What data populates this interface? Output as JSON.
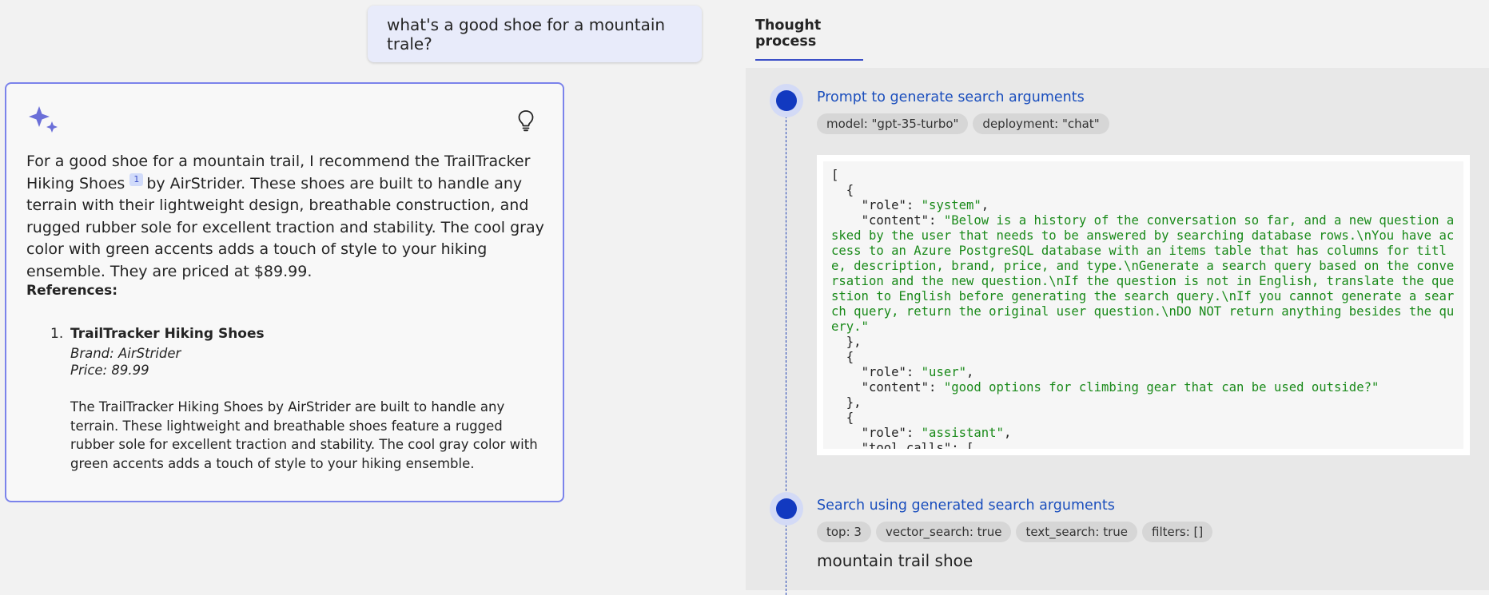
{
  "chat": {
    "user_question": "what's a good shoe for a mountain trale?",
    "answer": {
      "text_before_citation": "For a good shoe for a mountain trail, I recommend the TrailTracker Hiking Shoes",
      "citation": "1",
      "text_after_citation": "by AirStrider. These shoes are built to handle any terrain with their lightweight design, breathable construction, and rugged rubber sole for excellent traction and stability. The cool gray color with green accents adds a touch of style to your hiking ensemble. They are priced at $89.99.",
      "references_heading": "References:",
      "references": [
        {
          "number": "1.",
          "title": "TrailTracker Hiking Shoes",
          "brand": "Brand: AirStrider",
          "price": "Price: 89.99",
          "description": "The TrailTracker Hiking Shoes by AirStrider are built to handle any terrain. These lightweight and breathable shoes feature a rugged rubber sole for excellent traction and stability. The cool gray color with green accents adds a touch of style to your hiking ensemble."
        }
      ]
    },
    "icons": {
      "assistant": "sparkle-icon",
      "thought_process": "lightbulb-icon"
    }
  },
  "thought_process": {
    "tab_label": "Thought process",
    "steps": [
      {
        "title": "Prompt to generate search arguments",
        "chips": [
          "model: \"gpt-35-turbo\"",
          "deployment: \"chat\""
        ],
        "code_lines": [
          "[",
          "  {",
          "    \"role\": \"system\",",
          "    \"content\": \"Below is a history of the conversation so far, and a new question asked by the user that needs to be answered by searching database rows.\\nYou have access to an Azure PostgreSQL database with an items table that has columns for title, description, brand, price, and type.\\nGenerate a search query based on the conversation and the new question.\\nIf the question is not in English, translate the question to English before generating the search query.\\nIf you cannot generate a search query, return the original user question.\\nDO NOT return anything besides the query.\"",
          "  },",
          "  {",
          "    \"role\": \"user\",",
          "    \"content\": \"good options for climbing gear that can be used outside?\"",
          "  },",
          "  {",
          "    \"role\": \"assistant\",",
          "    \"tool_calls\": ["
        ]
      },
      {
        "title": "Search using generated search arguments",
        "chips": [
          "top: 3",
          "vector_search: true",
          "text_search: true",
          "filters: []"
        ],
        "result": "mountain trail shoe"
      }
    ]
  },
  "colors": {
    "accent": "#3b4fc7",
    "card_border": "#7b83eb",
    "step_dot": "#1239c0",
    "step_title": "#1a4ebd",
    "code_string": "#1a8a1a"
  }
}
